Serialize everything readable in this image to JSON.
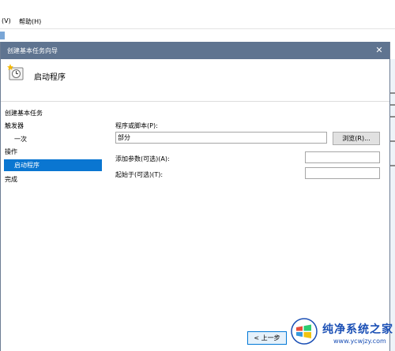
{
  "background_app": {
    "menu": [
      {
        "label": "(V)"
      },
      {
        "label": "帮助(H)"
      }
    ]
  },
  "dialog": {
    "title": "创建基本任务向导",
    "close_symbol": "✕",
    "header_title": "启动程序",
    "nav_items": [
      {
        "label": "创建基本任务"
      },
      {
        "label": "触发器"
      },
      {
        "label": "一次"
      },
      {
        "label": "操作"
      },
      {
        "label": "启动程序"
      },
      {
        "label": "完成"
      }
    ],
    "form": {
      "program_label": "程序或脚本(P):",
      "program_value": "部分",
      "browse_button": "浏览(R)...",
      "args_label": "添加参数(可选)(A):",
      "args_value": "",
      "start_in_label": "起始于(可选)(T):",
      "start_in_value": ""
    },
    "back_button": "< 上一步"
  },
  "watermark": {
    "name": "纯净系统之家",
    "url": "www.ycwjzy.com"
  },
  "colors": {
    "titlebar": "#5f7490",
    "selection": "#0a76d1",
    "watermark_blue": "#1a4fb5"
  },
  "icons": [
    "clock-program-icon",
    "close-icon",
    "windows-logo-icon"
  ]
}
